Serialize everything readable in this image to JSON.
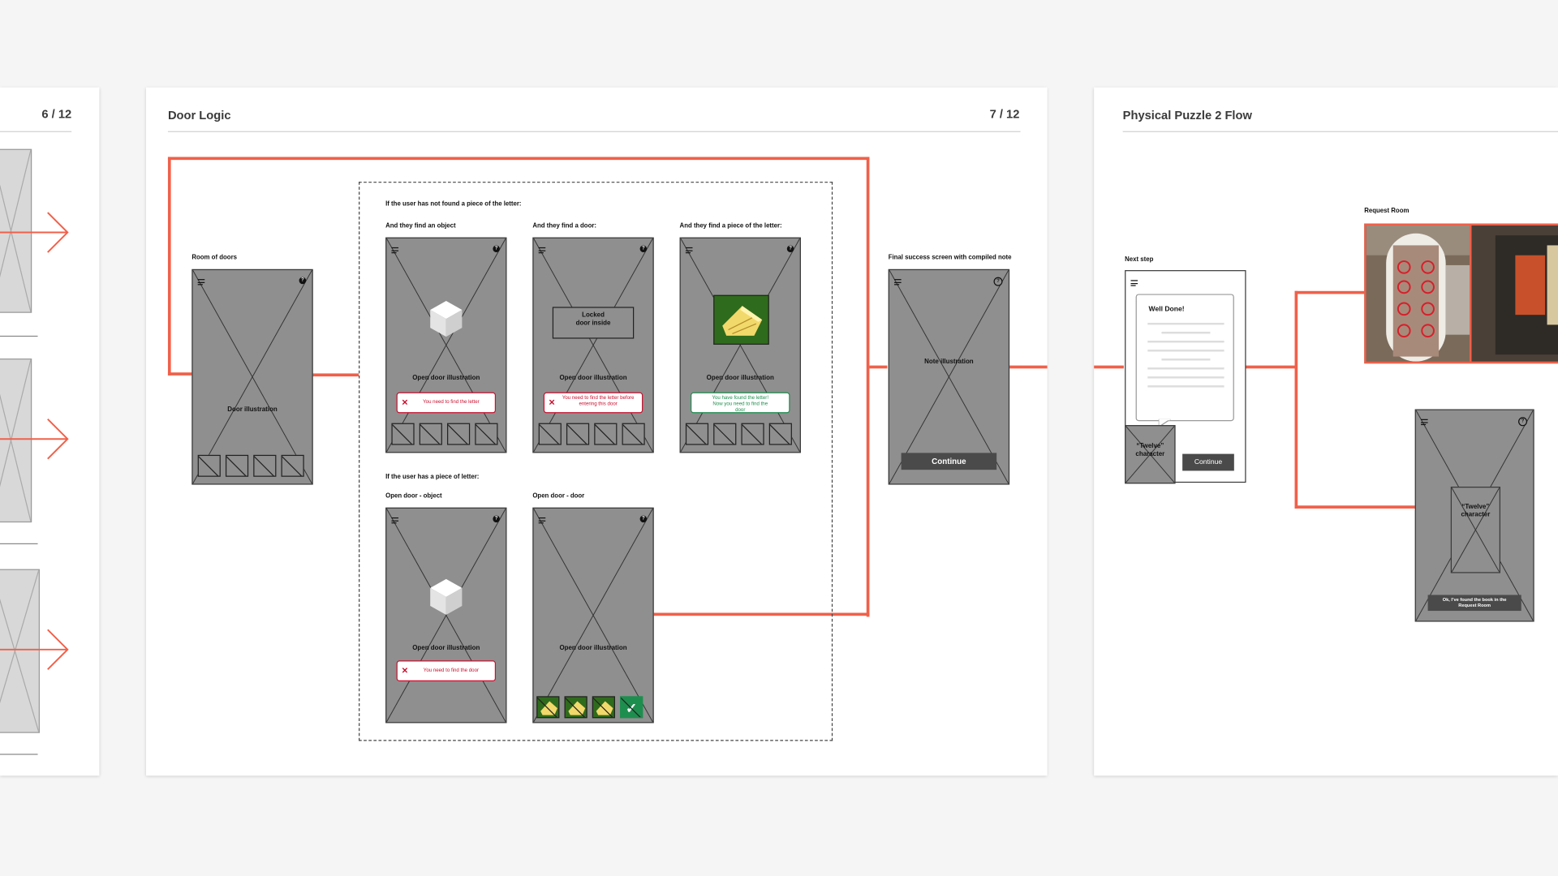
{
  "left_board": {
    "page_number": "6 / 12"
  },
  "door_logic": {
    "title": "Door Logic",
    "page_number": "7 / 12",
    "room_of_doors": {
      "label": "Room of doors",
      "caption": "Door illustration"
    },
    "not_found_heading": "If the user has not found a piece of the letter:",
    "object_case": {
      "label": "And they find an object",
      "caption": "Open door illustration",
      "message": "You need to find the letter"
    },
    "door_case": {
      "label": "And they find a door:",
      "locked_text": "Locked door inside",
      "caption": "Open door illustration",
      "message": "You need to find the letter before entering this door"
    },
    "letter_case": {
      "label": "And they find a piece of the letter:",
      "caption": "Open door illustration",
      "message": "You have found the letter! Now you need to find the door"
    },
    "has_letter_heading": "If the user has a piece of letter:",
    "open_object": {
      "label": "Open door - object",
      "caption": "Open door illustration",
      "message": "You need to find the door"
    },
    "open_door": {
      "label": "Open door - door",
      "caption": "Open door illustration"
    },
    "final": {
      "label": "Final success screen with compiled note",
      "caption": "Note illustration",
      "button": "Continue"
    }
  },
  "puzzle_flow": {
    "title": "Physical Puzzle 2 Flow",
    "next_step": {
      "label": "Next step",
      "heading": "Well Done!",
      "character": "“Twelve” character",
      "button": "Continue"
    },
    "request_room_label": "Request Room",
    "request_phone": {
      "character": "“Twelve” character",
      "button": "Ok, I’ve found the book in the Request Room"
    }
  },
  "colors": {
    "flow_line": "#f0604a",
    "error": "#c8102e",
    "success": "#1e8e4e",
    "wireframe_fill": "#8f8f8f"
  },
  "icons": [
    "menu-icon",
    "help-icon",
    "close-icon",
    "check-icon",
    "cube-icon"
  ]
}
